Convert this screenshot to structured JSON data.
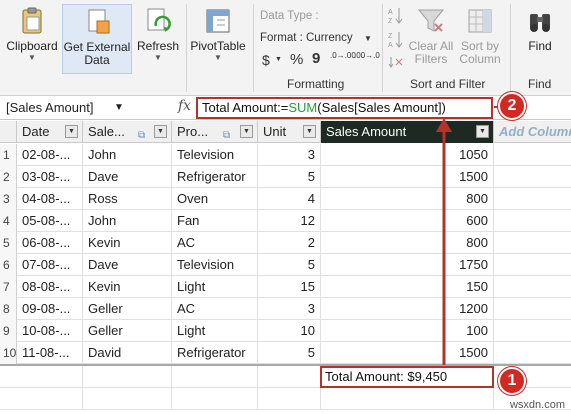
{
  "ribbon": {
    "clipboard": {
      "label": "Clipboard"
    },
    "get_external": {
      "label_line1": "Get External",
      "label_line2": "Data"
    },
    "refresh": {
      "label": "Refresh"
    },
    "pivot": {
      "label": "PivotTable"
    },
    "formatting": {
      "data_type": "Data Type :",
      "format": "Format : Currency",
      "dollar": "$",
      "percent": "%",
      "comma": "9",
      "dec_inc": ".0→.00",
      "dec_dec": ".00→.0",
      "group_label": "Formatting"
    },
    "sort": {
      "clear_filters_l1": "Clear All",
      "clear_filters_l2": "Filters",
      "sort_by_l1": "Sort by",
      "sort_by_l2": "Column",
      "group_label": "Sort and Filter"
    },
    "find": {
      "label": "Find",
      "group_label": "Find"
    }
  },
  "formula_bar": {
    "name_box": "[Sales Amount]",
    "fx": "fx",
    "formula_prefix": "Total Amount:=",
    "formula_fn": "SUM",
    "formula_rest": "(Sales[Sales Amount])"
  },
  "table": {
    "columns": [
      "Date",
      "Sale...",
      "Pro...",
      "Unit",
      "Sales Amount",
      "Add Column"
    ],
    "rows": [
      {
        "n": "1",
        "date": "02-08-...",
        "seller": "John",
        "product": "Television",
        "unit": "3",
        "amount": "1050"
      },
      {
        "n": "2",
        "date": "03-08-...",
        "seller": "Dave",
        "product": "Refrigerator",
        "unit": "5",
        "amount": "1500"
      },
      {
        "n": "3",
        "date": "04-08-...",
        "seller": "Ross",
        "product": "Oven",
        "unit": "4",
        "amount": "800"
      },
      {
        "n": "4",
        "date": "05-08-...",
        "seller": "John",
        "product": "Fan",
        "unit": "12",
        "amount": "600"
      },
      {
        "n": "5",
        "date": "06-08-...",
        "seller": "Kevin",
        "product": "AC",
        "unit": "2",
        "amount": "800"
      },
      {
        "n": "6",
        "date": "07-08-...",
        "seller": "Dave",
        "product": "Television",
        "unit": "5",
        "amount": "1750"
      },
      {
        "n": "7",
        "date": "08-08-...",
        "seller": "Kevin",
        "product": "Light",
        "unit": "15",
        "amount": "150"
      },
      {
        "n": "8",
        "date": "09-08-...",
        "seller": "Geller",
        "product": "AC",
        "unit": "3",
        "amount": "1200"
      },
      {
        "n": "9",
        "date": "10-08-...",
        "seller": "Geller",
        "product": "Light",
        "unit": "10",
        "amount": "100"
      },
      {
        "n": "10",
        "date": "11-08-...",
        "seller": "David",
        "product": "Refrigerator",
        "unit": "5",
        "amount": "1500"
      }
    ],
    "total": "Total Amount: $9,450"
  },
  "callouts": {
    "one": "1",
    "two": "2"
  },
  "watermark": "wsxdn.com",
  "colors": {
    "accent_red": "#d12a24",
    "header_dark": "#1d2a23",
    "formula_fn": "#1f9e3a"
  }
}
